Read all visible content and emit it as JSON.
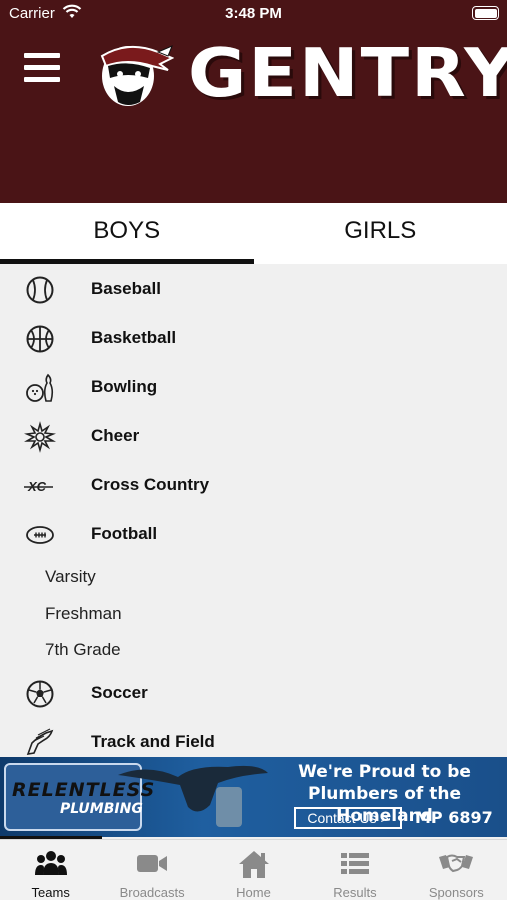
{
  "status_bar": {
    "carrier": "Carrier",
    "time": "3:48 PM"
  },
  "header": {
    "brand": "GENTRY"
  },
  "tabs": [
    {
      "label": "BOYS",
      "active": true
    },
    {
      "label": "GIRLS",
      "active": false
    }
  ],
  "sports": [
    {
      "label": "Baseball",
      "icon": "baseball-icon"
    },
    {
      "label": "Basketball",
      "icon": "basketball-icon"
    },
    {
      "label": "Bowling",
      "icon": "bowling-icon"
    },
    {
      "label": "Cheer",
      "icon": "cheer-icon"
    },
    {
      "label": "Cross Country",
      "icon": "cross-country-icon",
      "icon_text": "XC"
    },
    {
      "label": "Football",
      "icon": "football-icon"
    }
  ],
  "football_levels": [
    "Varsity",
    "Freshman",
    "7th Grade"
  ],
  "sports_after": [
    {
      "label": "Soccer",
      "icon": "soccer-icon"
    },
    {
      "label": "Track and Field",
      "icon": "track-shoe-icon"
    }
  ],
  "ad": {
    "brand_line1": "RELENTLESS",
    "brand_line2": "PLUMBING",
    "headline_line1": "We're Proud to be",
    "headline_line2": "Plumbers of the Homeland",
    "contact": "Contact Us >",
    "license": "MP 6897"
  },
  "tabbar": [
    {
      "label": "Teams",
      "icon": "teams-icon",
      "active": true
    },
    {
      "label": "Broadcasts",
      "icon": "video-camera-icon",
      "active": false
    },
    {
      "label": "Home",
      "icon": "home-icon",
      "active": false
    },
    {
      "label": "Results",
      "icon": "list-icon",
      "active": false
    },
    {
      "label": "Sponsors",
      "icon": "handshake-icon",
      "active": false
    }
  ],
  "colors": {
    "header_bg": "#4a1416",
    "list_bg": "#f0f0f0",
    "ad_bg": "#1f5fa0",
    "active_tab": "#111111",
    "inactive_tab": "#8a8a8a"
  }
}
